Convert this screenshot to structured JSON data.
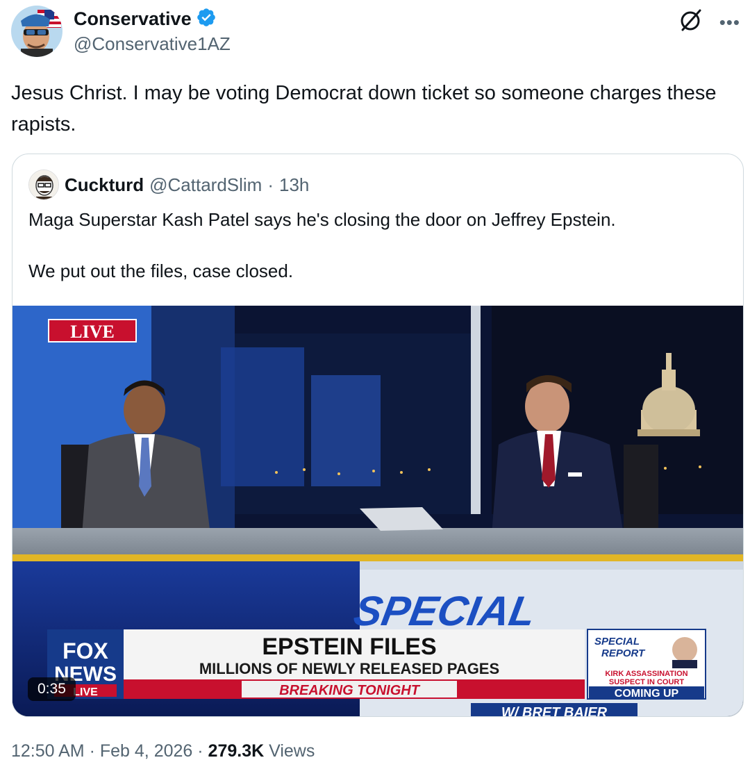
{
  "author": {
    "display_name": "Conservative",
    "handle": "@Conservative1AZ",
    "verified": true
  },
  "tweet": {
    "text": "Jesus Christ. I may be voting Democrat down ticket so someone charges these rapists."
  },
  "quoted_post": {
    "display_name": "Cuckturd",
    "handle": "@CattardSlim",
    "separator": "·",
    "age": "13h",
    "paragraph_1": "Maga Superstar Kash Patel says he's closing the door on Jeffrey Epstein.",
    "paragraph_2": "We put out the files, case closed.",
    "video": {
      "duration": "0:35",
      "overlay": {
        "live_badge": "LIVE",
        "network_logo_line1": "FOX",
        "network_logo_line2": "NEWS",
        "network_logo_line3": "LIVE",
        "set_sign": "SPECIAL",
        "headline": "EPSTEIN FILES",
        "subheadline": "MILLIONS OF NEWLY RELEASED PAGES",
        "breaking": "BREAKING TONIGHT",
        "promo_title_1": "SPECIAL",
        "promo_title_2": "REPORT",
        "promo_line_1": "KIRK ASSASSINATION",
        "promo_line_2": "SUSPECT IN COURT",
        "promo_coming": "COMING UP",
        "host_credit": "W/ BRET BAIER"
      }
    }
  },
  "meta": {
    "time": "12:50 AM",
    "sep1": "·",
    "date": "Feb 4, 2026",
    "sep2": "·",
    "views_count": "279.3K",
    "views_label": "Views"
  },
  "icons": {
    "verified": "verified-badge-icon",
    "grok": "grok-icon",
    "more": "more-icon"
  },
  "colors": {
    "verified_blue": "#1d9bf0",
    "text_primary": "#0f1419",
    "text_secondary": "#536471",
    "border": "#cfd9de"
  }
}
